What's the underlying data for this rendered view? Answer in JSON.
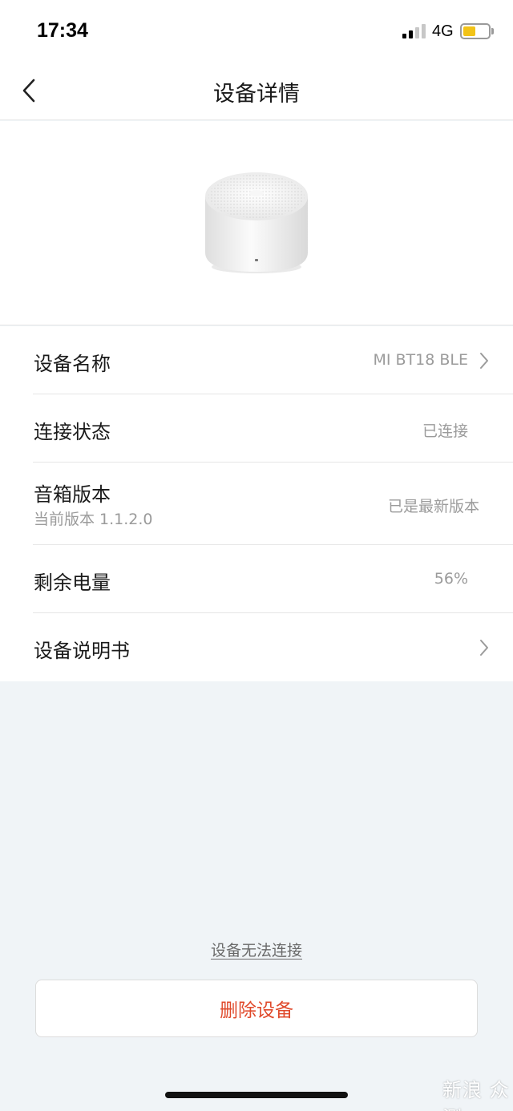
{
  "status_bar": {
    "time": "17:34",
    "network": "4G",
    "battery_level_fraction": 0.45,
    "battery_color": "#f2c318"
  },
  "nav": {
    "title": "设备详情",
    "back_icon": "chevron-left-icon"
  },
  "device": {
    "image": "speaker-icon"
  },
  "rows": [
    {
      "label": "设备名称",
      "value": "MI BT18 BLE",
      "chevron": true
    },
    {
      "label": "连接状态",
      "value": "已连接",
      "chevron": false
    },
    {
      "label": "音箱版本",
      "sub": "当前版本 1.1.2.0",
      "value": "已是最新版本",
      "chevron": false
    },
    {
      "label": "剩余电量",
      "value": "56%",
      "chevron": false
    },
    {
      "label": "设备说明书",
      "value": "",
      "chevron": true
    }
  ],
  "help_link": "设备无法连接",
  "delete_button": "删除设备",
  "accent_color": "#e04a2c",
  "watermark": "新浪 众测"
}
